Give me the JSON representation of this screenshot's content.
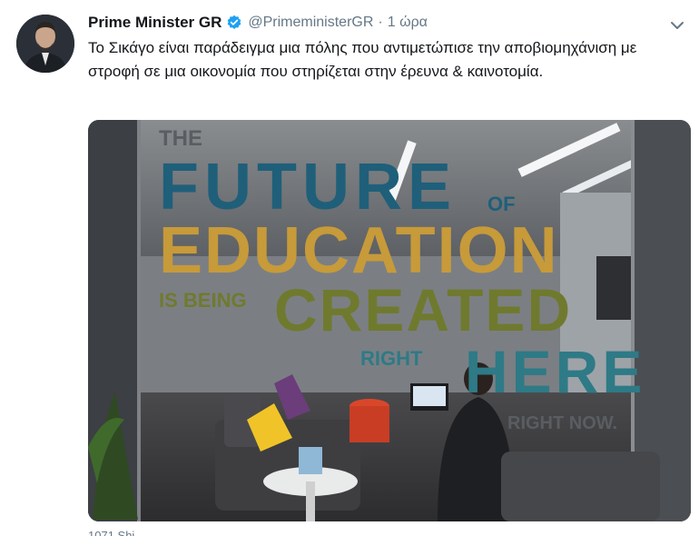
{
  "tweet": {
    "display_name": "Prime Minister GR",
    "handle": "@PrimeministerGR",
    "separator": "·",
    "time": "1 ώρα",
    "text": "Το Σικάγο είναι παράδειγμα μια πόλης που αντιμετώπισε την αποβιομηχάνιση με στροφή σε μια οικονομία που στηρίζεται στην έρευνα & καινοτομία.",
    "footer_count": "1071 Shi..."
  },
  "photo_sign": {
    "line1": "THE",
    "line2": "FUTURE",
    "line2b": "OF",
    "line3": "EDUCATION",
    "line4a": "IS BEING",
    "line4b": "CREATED",
    "line5a": "RIGHT",
    "line5b": "HERE",
    "line6": "RIGHT NOW."
  },
  "colors": {
    "verified": "#1da1f2",
    "sign_blue": "#1f5f7a",
    "sign_gold": "#c79a3a",
    "sign_olive": "#6f7a2e",
    "sign_teal": "#2e7a86"
  },
  "icons": {
    "verified": "verified-badge-icon",
    "menu": "chevron-down-icon"
  }
}
